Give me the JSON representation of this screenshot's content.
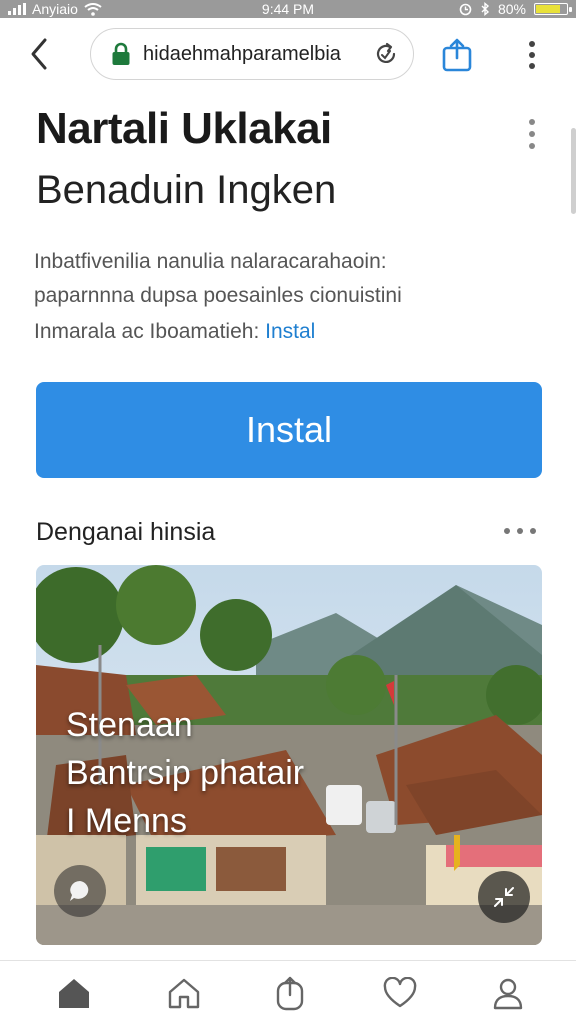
{
  "status": {
    "carrier": "Anyiaio",
    "time": "9:44 PM",
    "battery": "80%",
    "battery_level": 0.8
  },
  "browser": {
    "url": "hidaehmahparamelbia"
  },
  "header": {
    "title": "Nartali Uklakai",
    "subtitle": "Benaduin Ingken"
  },
  "description": {
    "line1": "Inbatfivenilia nanulia nalaracarahaoin:",
    "line2": "paparnnna dupsa poesainles cionuistini",
    "line3": "Inmarala ac Iboamatieh:",
    "link": "Instal"
  },
  "install_button": {
    "label": "Instal"
  },
  "section": {
    "title": "Denganai hinsia"
  },
  "photo": {
    "caption_lines": [
      "Stenaan",
      "Bantrsip phatair",
      "I Menns"
    ]
  },
  "colors": {
    "accent": "#2f8de4",
    "link": "#1f7fd0",
    "lock": "#1e7a3c",
    "share": "#2a86d9",
    "battery": "#e8e13a"
  },
  "icons": {
    "back": "chevron-left-icon",
    "lock": "lock-icon",
    "reload": "reload-icon",
    "share": "share-icon",
    "more": "kebab-icon",
    "tabs": [
      "home-filled-icon",
      "home-outline-icon",
      "share-outline-icon",
      "heart-icon",
      "profile-icon"
    ]
  }
}
